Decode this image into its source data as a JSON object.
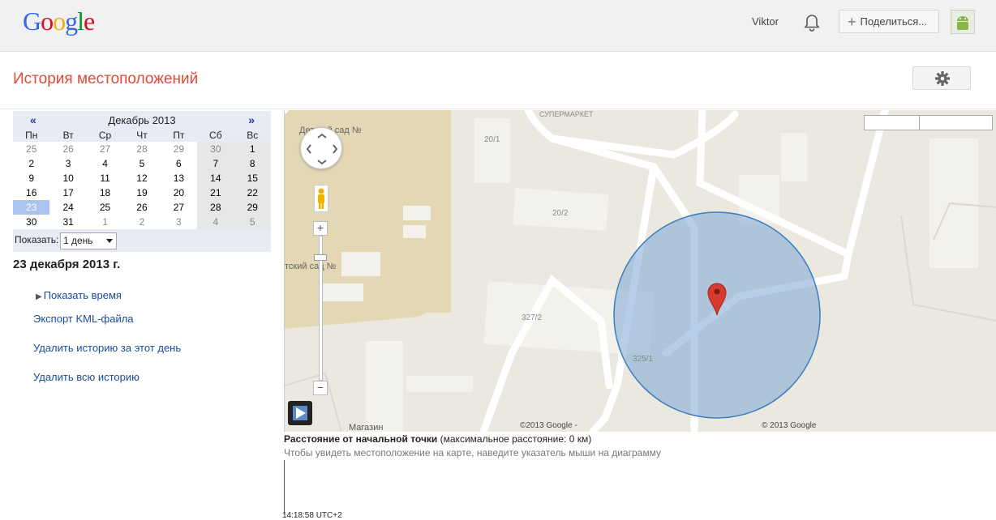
{
  "header": {
    "logo_letters": [
      "G",
      "o",
      "o",
      "g",
      "l",
      "e"
    ],
    "user_name": "Viktor",
    "share_label": "Поделиться...",
    "bell_icon": "bell-icon",
    "avatar_icon": "android-avatar-icon"
  },
  "page": {
    "title": "История местоположений",
    "settings_icon": "gear-icon"
  },
  "calendar": {
    "prev": "«",
    "next": "»",
    "month": "Декабрь 2013",
    "weekdays": [
      "Пн",
      "Вт",
      "Ср",
      "Чт",
      "Пт",
      "Сб",
      "Вс"
    ],
    "weeks": [
      [
        "25",
        "26",
        "27",
        "28",
        "29",
        "30",
        "1"
      ],
      [
        "2",
        "3",
        "4",
        "5",
        "6",
        "7",
        "8"
      ],
      [
        "9",
        "10",
        "11",
        "12",
        "13",
        "14",
        "15"
      ],
      [
        "16",
        "17",
        "18",
        "19",
        "20",
        "21",
        "22"
      ],
      [
        "23",
        "24",
        "25",
        "26",
        "27",
        "28",
        "29"
      ],
      [
        "30",
        "31",
        "1",
        "2",
        "3",
        "4",
        "5"
      ]
    ],
    "selected_day": "23",
    "show_label": "Показать:",
    "show_value": "1 день"
  },
  "sidebar": {
    "date_heading": "23 декабря 2013 г.",
    "show_time": "Показать время",
    "export_kml": "Экспорт KML-файла",
    "delete_day": "Удалить историю за этот день",
    "delete_all": "Удалить всю историю"
  },
  "map": {
    "labels": {
      "supermarket": "СУПЕРМАРКЕТ",
      "kindergarten_top": "Детский сад №",
      "kindergarten_left": "тский сад №",
      "b20_1": "20/1",
      "b20_2": "20/2",
      "b327_2": "327/2",
      "b325_1": "325/1",
      "shop": "Магазин"
    },
    "copyright_left": "©2013 Google -",
    "copyright_right": "© 2013 Google",
    "accuracy_circle_color": "#7aa6d4",
    "marker_color": "#d93a2f"
  },
  "chart": {
    "distance_label": "Расстояние от начальной точки",
    "distance_value": "(максимальное расстояние: 0 км)",
    "hint": "Чтобы увидеть местоположение на карте, наведите указатель мыши на диаграмму",
    "time_label": "14:18:58 UTC+2"
  }
}
